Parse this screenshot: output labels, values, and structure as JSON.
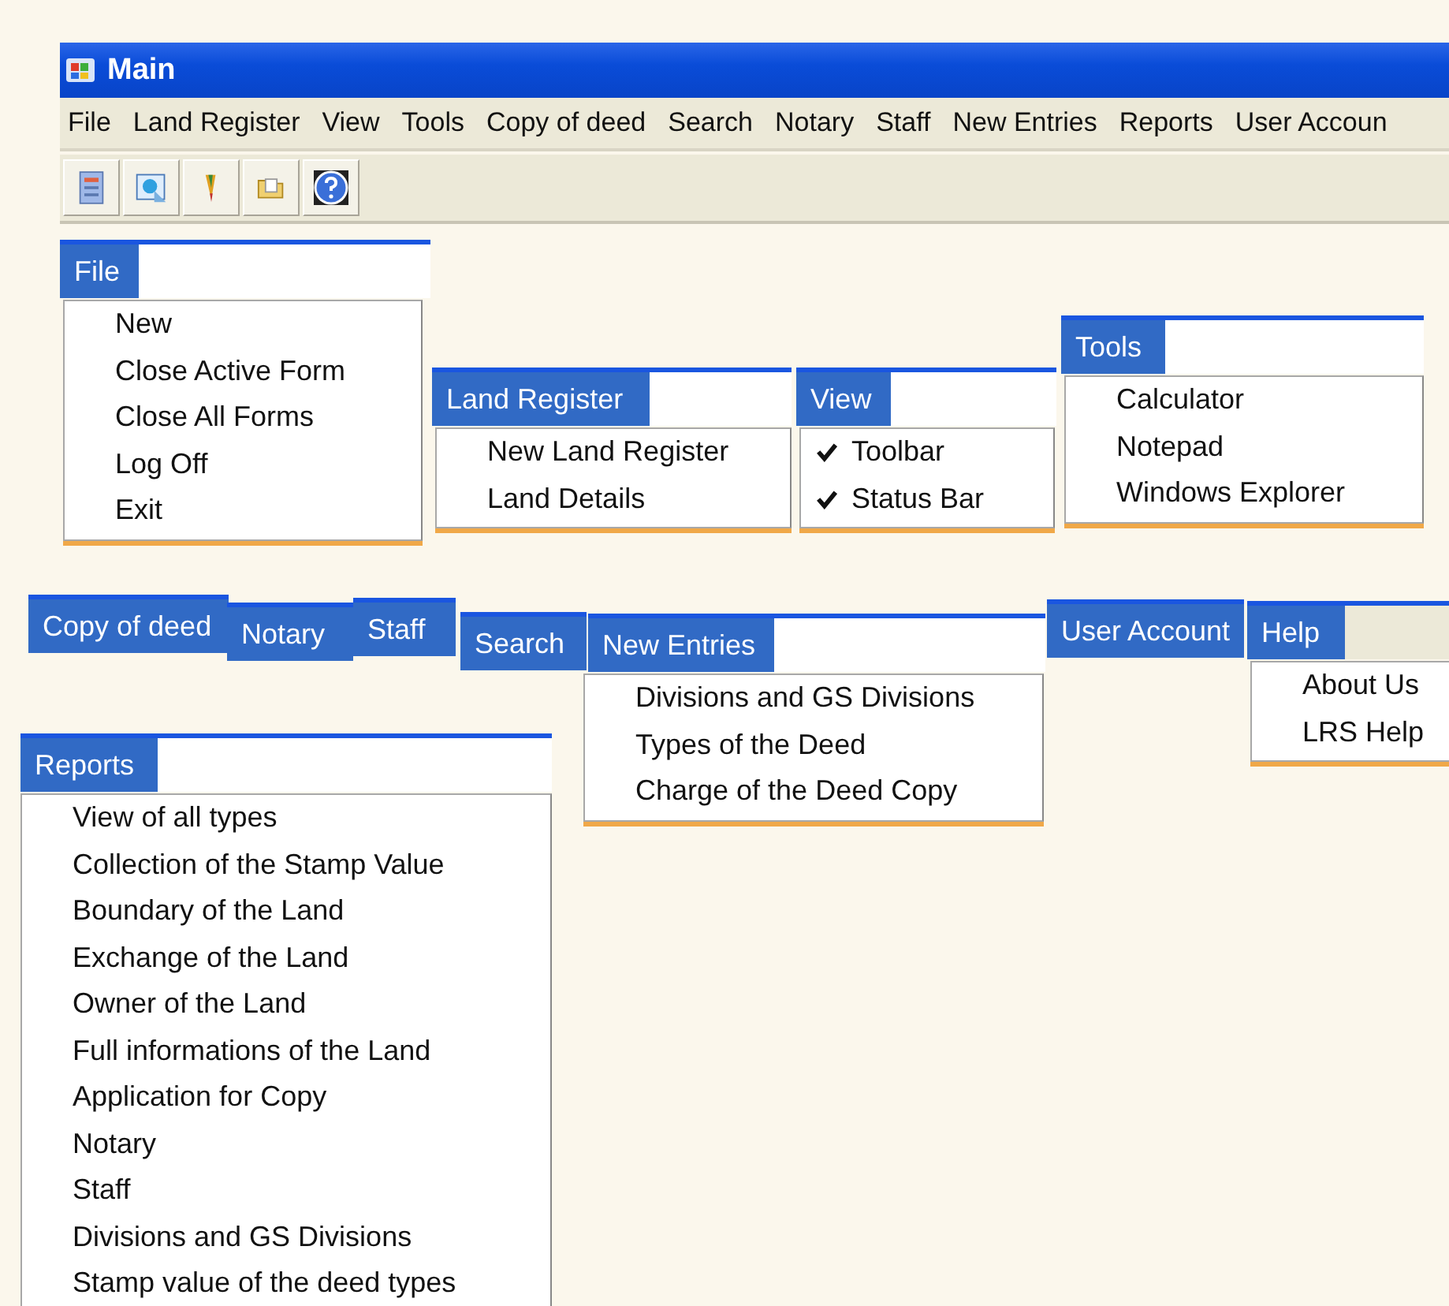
{
  "window": {
    "title": "Main"
  },
  "menubar": [
    "File",
    "Land Register",
    "View",
    "Tools",
    "Copy of deed",
    "Search",
    "Notary",
    "Staff",
    "New Entries",
    "Reports",
    "User Accoun"
  ],
  "menus": [
    {
      "title": "File",
      "items": [
        {
          "label": "New"
        },
        {
          "label": "Close Active Form"
        },
        {
          "label": "Close All Forms"
        },
        {
          "label": "Log Off"
        },
        {
          "label": "Exit"
        }
      ]
    },
    {
      "title": "Land Register",
      "items": [
        {
          "label": "New Land Register"
        },
        {
          "label": "Land Details"
        }
      ]
    },
    {
      "title": "View",
      "items": [
        {
          "label": "Toolbar",
          "checked": true
        },
        {
          "label": "Status Bar",
          "checked": true
        }
      ]
    },
    {
      "title": "Tools",
      "items": [
        {
          "label": "Calculator"
        },
        {
          "label": "Notepad"
        },
        {
          "label": "Windows Explorer"
        }
      ]
    },
    {
      "title": "Copy of deed"
    },
    {
      "title": "Notary"
    },
    {
      "title": "Staff"
    },
    {
      "title": "Search"
    },
    {
      "title": "New Entries",
      "items": [
        {
          "label": "Divisions and GS Divisions"
        },
        {
          "label": "Types of the Deed"
        },
        {
          "label": "Charge of the Deed Copy"
        }
      ]
    },
    {
      "title": "User Account"
    },
    {
      "title": "Help",
      "items": [
        {
          "label": "About Us"
        },
        {
          "label": "LRS Help"
        }
      ]
    },
    {
      "title": "Reports",
      "items": [
        {
          "label": "View of all types"
        },
        {
          "label": "Collection of the Stamp Value"
        },
        {
          "label": "Boundary of the Land"
        },
        {
          "label": "Exchange of the Land"
        },
        {
          "label": "Owner of the Land"
        },
        {
          "label": "Full informations of the Land"
        },
        {
          "label": "Application for Copy"
        },
        {
          "label": "Notary"
        },
        {
          "label": "Staff"
        },
        {
          "label": "Divisions and GS Divisions"
        },
        {
          "label": "Stamp value of the deed types"
        }
      ]
    }
  ]
}
